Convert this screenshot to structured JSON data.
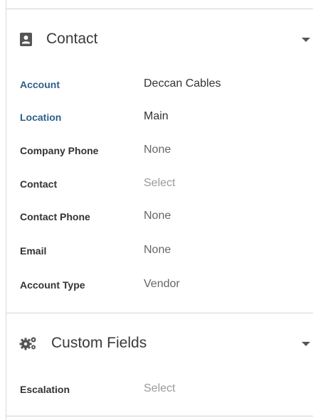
{
  "contact_section": {
    "title": "Contact",
    "icon": "contact-book-icon",
    "fields": [
      {
        "label": "Account",
        "value": "Deccan Cables"
      },
      {
        "label": "Location",
        "value": "Main"
      },
      {
        "label": "Company Phone",
        "value": "None"
      },
      {
        "label": "Contact",
        "value": "Select"
      },
      {
        "label": "Contact Phone",
        "value": "None"
      },
      {
        "label": "Email",
        "value": "None"
      },
      {
        "label": "Account Type",
        "value": "Vendor"
      }
    ]
  },
  "custom_fields_section": {
    "title": "Custom Fields",
    "icon": "gears-icon",
    "fields": [
      {
        "label": "Escalation",
        "value": "Select"
      }
    ]
  },
  "colors": {
    "link_label": "#2d5f8a",
    "label": "#333333",
    "value": "#666666",
    "placeholder": "#9a9a9a",
    "divider": "#d6d6d6"
  }
}
